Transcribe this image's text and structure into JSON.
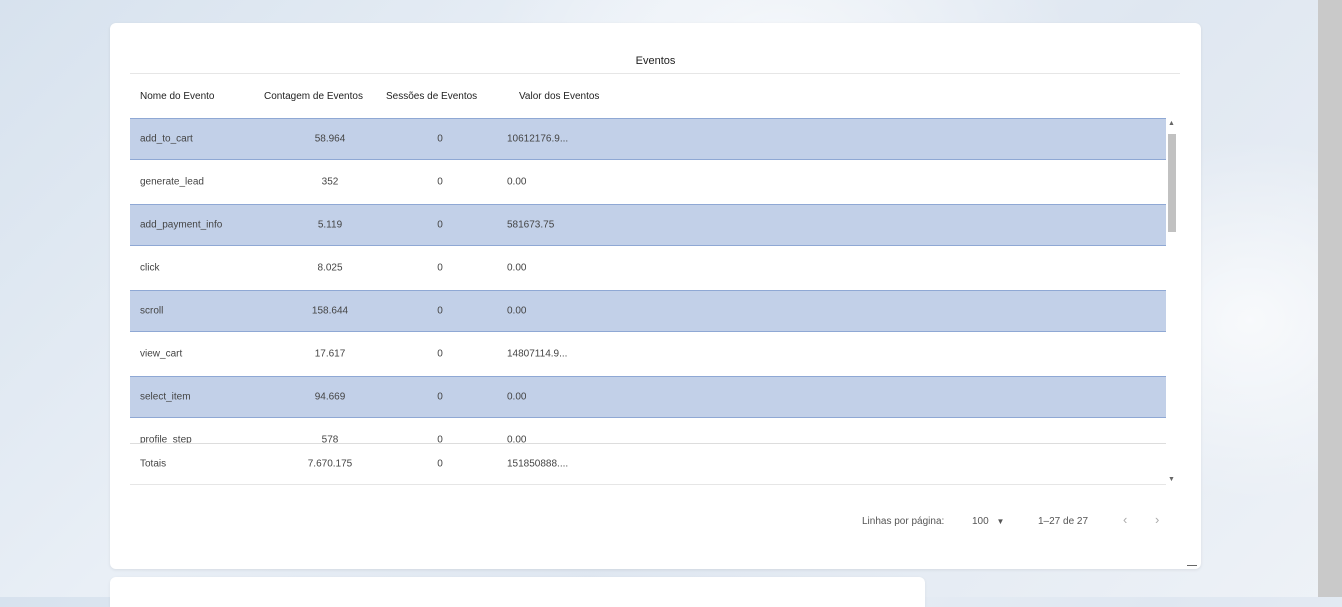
{
  "table": {
    "title": "Eventos",
    "columns": [
      "Nome do Evento",
      "Contagem de Eventos",
      "Sessões de Eventos",
      "Valor dos Eventos"
    ],
    "rows": [
      {
        "name": "add_to_cart",
        "count": "58.964",
        "sessions": "0",
        "value": "10612176.9..."
      },
      {
        "name": "generate_lead",
        "count": "352",
        "sessions": "0",
        "value": "0.00"
      },
      {
        "name": "add_payment_info",
        "count": "5.119",
        "sessions": "0",
        "value": "581673.75"
      },
      {
        "name": "click",
        "count": "8.025",
        "sessions": "0",
        "value": "0.00"
      },
      {
        "name": "scroll",
        "count": "158.644",
        "sessions": "0",
        "value": "0.00"
      },
      {
        "name": "view_cart",
        "count": "17.617",
        "sessions": "0",
        "value": "14807114.9..."
      },
      {
        "name": "select_item",
        "count": "94.669",
        "sessions": "0",
        "value": "0.00"
      },
      {
        "name": "profile_step",
        "count": "578",
        "sessions": "0",
        "value": "0.00"
      }
    ],
    "totals": {
      "label": "Totais",
      "count": "7.670.175",
      "sessions": "0",
      "value": "151850888...."
    }
  },
  "pagination": {
    "rows_per_page_label": "Linhas por página:",
    "rows_per_page_value": "100",
    "range": "1–27 de 27",
    "prev_icon": "chevron-left-icon",
    "next_icon": "chevron-right-icon"
  },
  "colors": {
    "highlight_row": "#c2d0e8",
    "highlight_border": "#8fa8d4"
  }
}
